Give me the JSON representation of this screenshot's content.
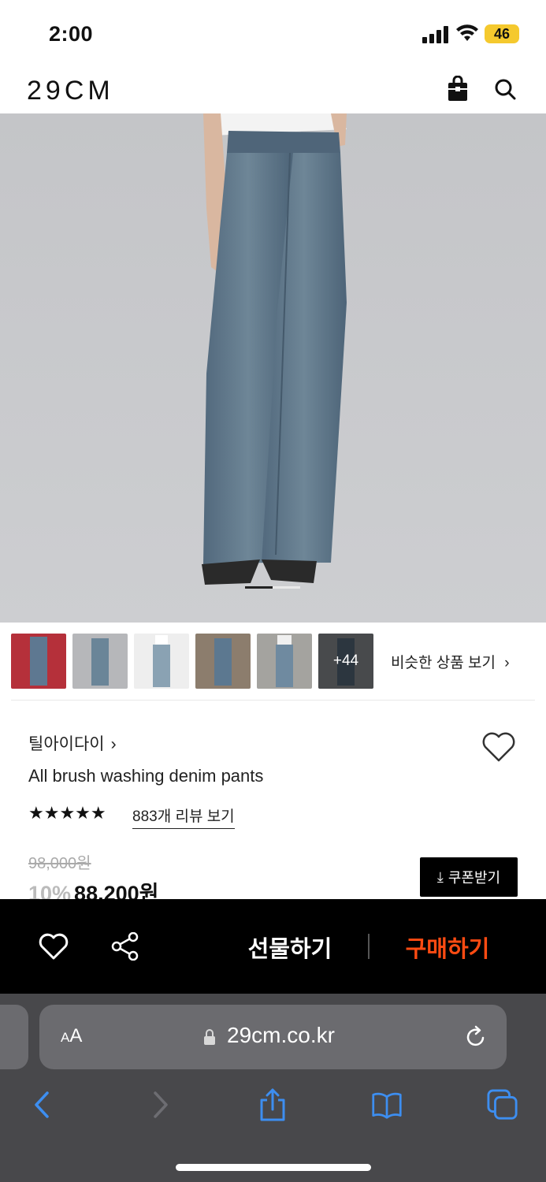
{
  "status": {
    "time": "2:00",
    "battery": "46"
  },
  "header": {
    "logo": "29CM",
    "icons": [
      "bag-icon",
      "search-icon"
    ]
  },
  "gallery": {
    "current_slide": 1,
    "slide_progress": 0.5,
    "more_count": "+44",
    "similar_label": "비슷한 상품 보기",
    "chevron": "›"
  },
  "product": {
    "brand": "틸아이다이",
    "brand_chevron": "›",
    "title": "All brush washing denim pants",
    "rating_stars": 5,
    "stars_text": "★★★★★",
    "review_label": "883개 리뷰 보기",
    "original_price": "98,000원",
    "discount": "10%",
    "sale_price": "88,200원",
    "coupon_label": "쿠폰받기",
    "coupon_icon": "⤓"
  },
  "actions": {
    "gift_label": "선물하기",
    "buy_label": "구매하기",
    "buy_color": "#ff4b12"
  },
  "browser": {
    "aa_label": "AA",
    "url": "29cm.co.kr"
  }
}
